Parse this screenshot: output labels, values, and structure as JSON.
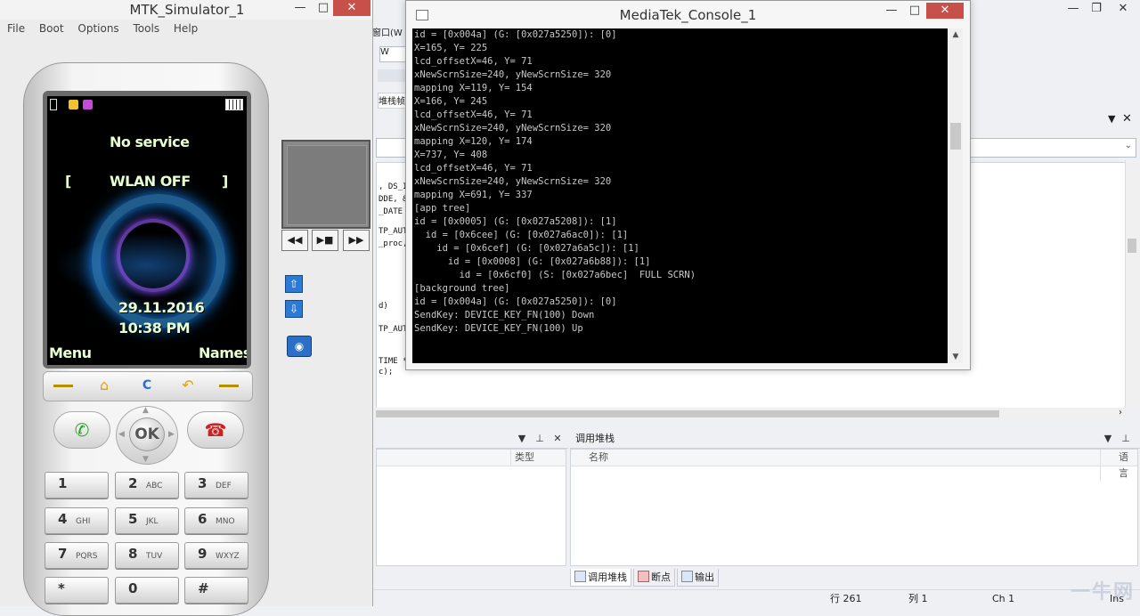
{
  "simulator": {
    "title": "MTK_Simulator_1",
    "window_buttons": {
      "minimize": "—",
      "maximize": "□",
      "close": "✕"
    },
    "menu": [
      "File",
      "Boot",
      "Options",
      "Tools",
      "Help"
    ],
    "screen": {
      "network": "No service",
      "wlan_open": "[",
      "wlan": "WLAN OFF",
      "wlan_close": "]",
      "date": "29.11.2016",
      "time": "10:38 PM",
      "left_soft": "Menu",
      "right_soft": "Names"
    },
    "soft_keys": {
      "home_icon": "home-icon",
      "clear": "C",
      "back_icon": "back-icon"
    },
    "nav_ok": "OK",
    "keypad": [
      {
        "num": "1",
        "letters": ""
      },
      {
        "num": "2",
        "letters": "ABC"
      },
      {
        "num": "3",
        "letters": "DEF"
      },
      {
        "num": "4",
        "letters": "GHI"
      },
      {
        "num": "5",
        "letters": "JKL"
      },
      {
        "num": "6",
        "letters": "MNO"
      },
      {
        "num": "7",
        "letters": "PQRS"
      },
      {
        "num": "8",
        "letters": "TUV"
      },
      {
        "num": "9",
        "letters": "WXYZ"
      },
      {
        "num": "*",
        "letters": ""
      },
      {
        "num": "0",
        "letters": ""
      },
      {
        "num": "#",
        "letters": ""
      }
    ],
    "media_buttons": [
      "◀◀",
      "▶■",
      "▶▶"
    ]
  },
  "console": {
    "title": "MediaTek_Console_1",
    "window_buttons": {
      "minimize": "—",
      "maximize": "□",
      "close": "✕"
    },
    "lines": [
      "id = [0x004a] (G: [0x027a5250]): [0]",
      "X=165, Y= 225",
      "lcd_offsetX=46, Y= 71",
      "xNewScrnSize=240, yNewScrnSize= 320",
      "mapping X=119, Y= 154",
      "X=166, Y= 245",
      "lcd_offsetX=46, Y= 71",
      "xNewScrnSize=240, yNewScrnSize= 320",
      "mapping X=120, Y= 174",
      "X=737, Y= 408",
      "lcd_offsetX=46, Y= 71",
      "xNewScrnSize=240, yNewScrnSize= 320",
      "mapping X=691, Y= 337",
      "[app tree]",
      "id = [0x0005] (G: [0x027a5208]): [1]",
      "  id = [0x6cee] (G: [0x027a6ac0]): [1]",
      "    id = [0x6cef] (G: [0x027a6a5c]): [1]",
      "      id = [0x0008] (G: [0x027a6b88]): [1]",
      "        id = [0x6cf0] (S: [0x027a6bec]  FULL SCRN)",
      "[background tree]",
      "id = [0x004a] (G: [0x027a5250]): [0]",
      "SendKey: DEVICE_KEY_FN(100) Down",
      "SendKey: DEVICE_KEY_FN(100) Up"
    ]
  },
  "ide": {
    "window_buttons": {
      "minimize": "—",
      "maximize": "❐",
      "close": "✕"
    },
    "menu_partial": "窗口(W",
    "toolbar_partial": "W",
    "tab_partial": "堆栈帧",
    "code_fragments": [
      ", DS_I",
      "DDE, &",
      "_DATE",
      "TP_AUT",
      "_proc,",
      "d)",
      "TP_AUT",
      "TIME *",
      "c);"
    ],
    "left_panel": {
      "col_type": "类型"
    },
    "call_stack": {
      "title": "调用堆栈",
      "col_name": "名称",
      "col_lang": "语言"
    },
    "bottom_tabs": [
      "调用堆栈",
      "断点",
      "输出"
    ],
    "status": {
      "line": "行 261",
      "col": "列 1",
      "ch": "Ch 1",
      "ins": "Ins"
    },
    "watermark": "一牛网"
  }
}
